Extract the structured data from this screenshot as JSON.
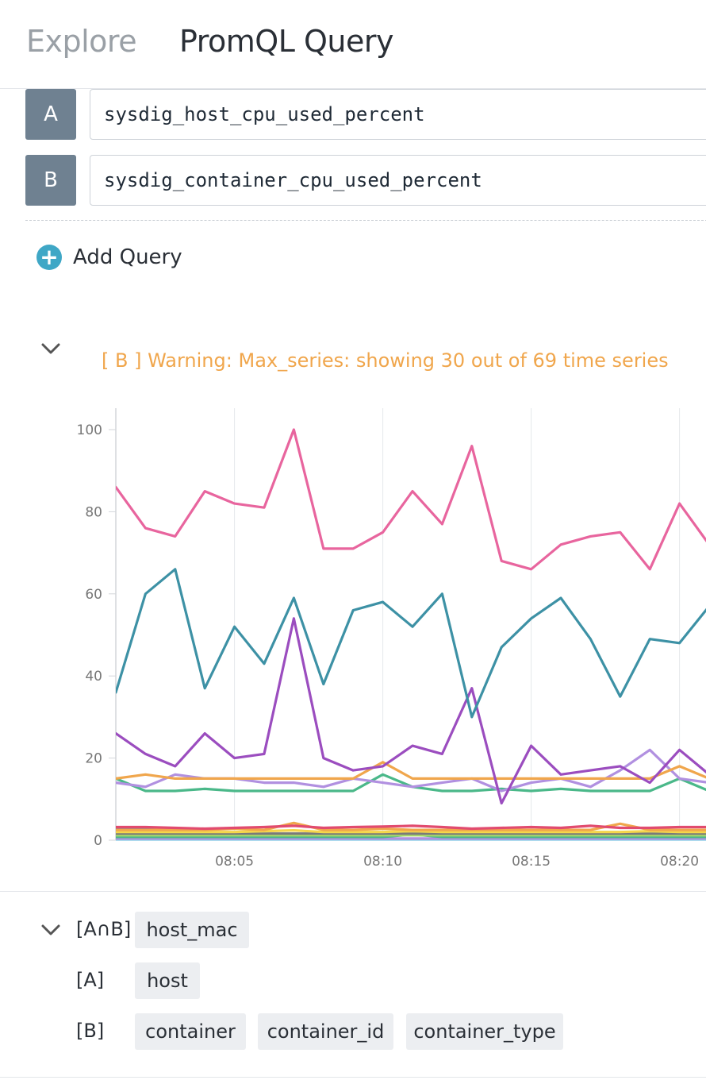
{
  "header": {
    "tabs": [
      {
        "label": "Explore"
      },
      {
        "label": "PromQL Query"
      }
    ]
  },
  "queries": [
    {
      "letter": "A",
      "expr": "sysdig_host_cpu_used_percent"
    },
    {
      "letter": "B",
      "expr": "sysdig_container_cpu_used_percent"
    }
  ],
  "add_query": {
    "label": "Add Query",
    "icon": "plus-circle-icon"
  },
  "warning": {
    "prefix": "[ B ] Warning:",
    "message": "Max_series: showing 30 out of 69 time series"
  },
  "chart_data": {
    "type": "line",
    "x_ticks": [
      "08:05",
      "08:10",
      "08:15",
      "08:20"
    ],
    "x_tick_index": [
      4,
      9,
      14,
      19
    ],
    "y_ticks": [
      "0",
      "20",
      "40",
      "60",
      "80",
      "100"
    ],
    "ylim": [
      0,
      100
    ],
    "grid": "vertical",
    "series": [
      {
        "color": "#e8659e",
        "values": [
          86,
          76,
          74,
          85,
          82,
          81,
          100,
          71,
          71,
          75,
          85,
          77,
          96,
          68,
          66,
          72,
          74,
          75,
          66,
          82,
          72
        ]
      },
      {
        "color": "#3d91a5",
        "values": [
          36,
          60,
          66,
          37,
          52,
          43,
          59,
          38,
          56,
          58,
          52,
          60,
          30,
          47,
          54,
          59,
          49,
          35,
          49,
          48,
          57
        ]
      },
      {
        "color": "#9b4dbf",
        "values": [
          26,
          21,
          18,
          26,
          20,
          21,
          54,
          20,
          17,
          18,
          23,
          21,
          37,
          9,
          23,
          16,
          17,
          18,
          14,
          22,
          16
        ]
      },
      {
        "color": "#f0a64c",
        "values": [
          15,
          16,
          15,
          15,
          15,
          15,
          15,
          15,
          15,
          19,
          15,
          15,
          15,
          15,
          15,
          15,
          15,
          15,
          15,
          18,
          15
        ]
      },
      {
        "color": "#b190e0",
        "values": [
          14,
          13,
          16,
          15,
          15,
          14,
          14,
          13,
          15,
          14,
          13,
          14,
          15,
          12,
          14,
          15,
          13,
          17,
          22,
          15,
          14
        ]
      },
      {
        "color": "#4ab889",
        "values": [
          15,
          12,
          12,
          12.5,
          12,
          12,
          12,
          12,
          12,
          16,
          13,
          12,
          12,
          12.5,
          12,
          12.5,
          12,
          12,
          12,
          15,
          12
        ]
      },
      {
        "color": "#e14b6f",
        "values": [
          3.2,
          3.2,
          3.0,
          2.8,
          3.0,
          3.2,
          3.5,
          3.0,
          3.2,
          3.3,
          3.5,
          3.2,
          2.8,
          3.0,
          3.2,
          3.0,
          3.5,
          3.0,
          3.0,
          3.2,
          3.2
        ]
      },
      {
        "color": "#f0a64c",
        "values": [
          2.5,
          2.5,
          2.5,
          2.5,
          2.8,
          2.5,
          4.2,
          2.5,
          2.5,
          2.8,
          2.5,
          2.5,
          2.5,
          2.5,
          2.5,
          2.5,
          2.5,
          4.0,
          2.5,
          2.5,
          2.5
        ]
      },
      {
        "color": "#5b6fa8",
        "values": [
          2.7,
          2.6,
          2.6,
          null,
          null,
          null,
          null,
          null,
          null,
          null,
          null,
          null,
          null,
          null,
          null,
          null,
          null,
          null,
          null,
          null,
          null
        ]
      },
      {
        "color": "#f5d64b",
        "values": [
          2.0,
          2.0,
          2.0,
          2.0,
          2.0,
          2.2,
          2.4,
          2.0,
          2.0,
          2.0,
          2.2,
          2.0,
          2.0,
          2.0,
          2.0,
          2.0,
          2.0,
          2.0,
          2.2,
          2.0,
          2.0
        ]
      },
      {
        "color": "#7a7a7a",
        "values": [
          1.6,
          1.6,
          1.6,
          1.6,
          1.6,
          1.6,
          1.6,
          1.6,
          1.6,
          1.6,
          1.6,
          1.6,
          1.6,
          1.6,
          1.6,
          1.6,
          1.6,
          1.6,
          1.6,
          1.6,
          1.6
        ]
      },
      {
        "color": "#a6d96a",
        "values": [
          1.2,
          1.2,
          1.2,
          1.2,
          1.2,
          1.2,
          1.2,
          1.2,
          1.2,
          1.2,
          1.2,
          1.2,
          1.2,
          1.2,
          1.2,
          1.2,
          1.2,
          1.2,
          1.2,
          1.2,
          1.2
        ]
      },
      {
        "color": "#4ab889",
        "values": [
          0.8,
          0.8,
          0.8,
          0.8,
          0.8,
          0.8,
          0.8,
          0.8,
          0.8,
          0.8,
          1.4,
          0.8,
          0.8,
          0.8,
          0.8,
          0.8,
          0.8,
          0.8,
          0.8,
          0.8,
          0.8
        ]
      },
      {
        "color": "#b190e0",
        "values": [
          0.4,
          0.4,
          0.4,
          0.4,
          0.4,
          0.4,
          0.4,
          0.4,
          0.4,
          0.4,
          0.4,
          0.4,
          0.4,
          0.4,
          0.4,
          0.4,
          0.4,
          0.4,
          0.4,
          0.4,
          0.4
        ]
      },
      {
        "color": "#7ec8e3",
        "values": [
          0.2,
          0.2,
          0.2,
          0.2,
          0.2,
          0.2,
          0.2,
          0.2,
          0.2,
          0.2,
          0.2,
          0.2,
          0.2,
          0.2,
          0.2,
          0.2,
          0.2,
          0.2,
          0.2,
          0.2,
          0.2
        ]
      }
    ]
  },
  "labels_panel": {
    "rows": [
      {
        "key": "[A∩B]",
        "tags": [
          "host_mac"
        ]
      },
      {
        "key": "[A]",
        "tags": [
          "host"
        ]
      },
      {
        "key": "[B]",
        "tags": [
          "container",
          "container_id",
          "container_type"
        ]
      }
    ]
  }
}
